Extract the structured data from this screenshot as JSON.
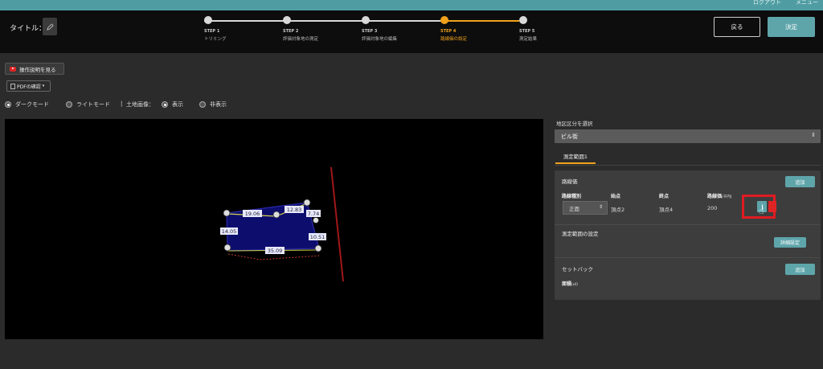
{
  "topbar": {
    "links": [
      "ログアウト",
      "メニュー"
    ]
  },
  "header": {
    "title_label": "タイトル：",
    "back_label": "戻る",
    "confirm_label": "決定"
  },
  "steps": [
    {
      "num": "STEP 1",
      "label": "トリミング",
      "active": false
    },
    {
      "num": "STEP 2",
      "label": "評価対象地の測定",
      "active": false
    },
    {
      "num": "STEP 3",
      "label": "評価対象地の編集",
      "active": false
    },
    {
      "num": "STEP 4",
      "label": "路線価の設定",
      "active": true
    },
    {
      "num": "STEP 5",
      "label": "測定結果",
      "active": false
    }
  ],
  "toolbar": {
    "help_label": "操作説明を見る",
    "pdf_label": "PDFの確認"
  },
  "display_options": {
    "dark_mode": "ダークモード",
    "light_mode": "ライトモード",
    "separator": "|",
    "land_image": "土地画像：",
    "show": "表示",
    "hide": "非表示",
    "selected_mode": "dark",
    "land_image_visible": true
  },
  "canvas": {
    "dimension_labels": [
      "19.06",
      "12.83",
      "7.74",
      "14.05",
      "10.51",
      "35.09"
    ]
  },
  "panel": {
    "district_label": "地区区分を選択",
    "district_value": "ビル街",
    "range_tab": "測定範囲1",
    "road_price": {
      "title": "路線価",
      "add_label": "追加",
      "headers": {
        "type": "路線種別",
        "start": "始点",
        "end": "終点",
        "price": "路線価",
        "price_unit": "(千円)"
      },
      "row": {
        "type": "正面",
        "start": "頂点2",
        "end": "頂点4",
        "price": "200"
      }
    },
    "range_settings": {
      "title": "測定範囲の設定",
      "detail_label": "詳細設定"
    },
    "setback": {
      "title": "セットバック",
      "add_label": "追加",
      "area_label": "面積",
      "area_unit": "(㎡)"
    }
  },
  "colors": {
    "accent": "#f0a21b",
    "teal": "#5ea5aa",
    "highlight": "#e01b22",
    "polygon_fill": "#0d0d6e"
  }
}
